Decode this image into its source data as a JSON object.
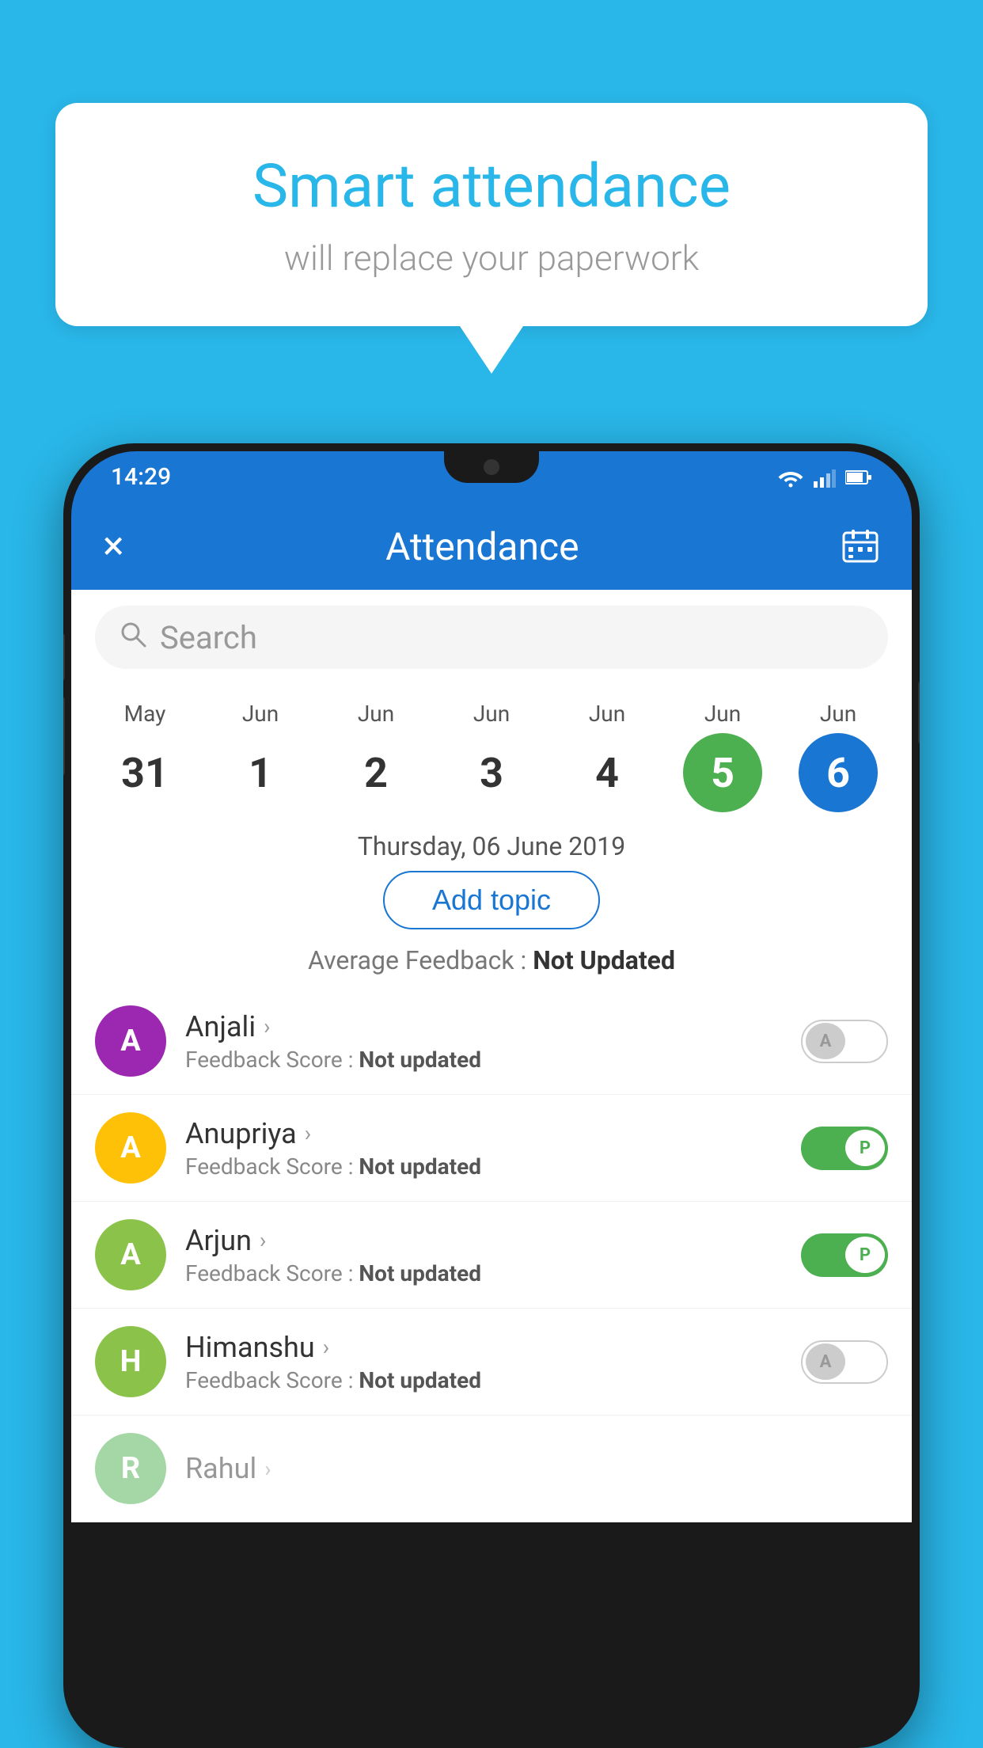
{
  "background_color": "#29B6E8",
  "speech_bubble": {
    "title": "Smart attendance",
    "subtitle": "will replace your paperwork"
  },
  "status_bar": {
    "time": "14:29",
    "wifi_icon": "wifi",
    "signal_icon": "signal",
    "battery_icon": "battery"
  },
  "app_bar": {
    "title": "Attendance",
    "close_label": "×",
    "calendar_icon": "calendar"
  },
  "search": {
    "placeholder": "Search"
  },
  "calendar": {
    "days": [
      {
        "month": "May",
        "date": "31",
        "state": "normal"
      },
      {
        "month": "Jun",
        "date": "1",
        "state": "normal"
      },
      {
        "month": "Jun",
        "date": "2",
        "state": "normal"
      },
      {
        "month": "Jun",
        "date": "3",
        "state": "normal"
      },
      {
        "month": "Jun",
        "date": "4",
        "state": "normal"
      },
      {
        "month": "Jun",
        "date": "5",
        "state": "today"
      },
      {
        "month": "Jun",
        "date": "6",
        "state": "selected"
      }
    ]
  },
  "selected_date": "Thursday, 06 June 2019",
  "add_topic_label": "Add topic",
  "average_feedback_label": "Average Feedback :",
  "average_feedback_value": "Not Updated",
  "students": [
    {
      "name": "Anjali",
      "avatar_letter": "A",
      "avatar_color": "#9C27B0",
      "feedback_label": "Feedback Score :",
      "feedback_value": "Not updated",
      "attendance": "off",
      "toggle_label": "A"
    },
    {
      "name": "Anupriya",
      "avatar_letter": "A",
      "avatar_color": "#FFC107",
      "feedback_label": "Feedback Score :",
      "feedback_value": "Not updated",
      "attendance": "on",
      "toggle_label": "P"
    },
    {
      "name": "Arjun",
      "avatar_letter": "A",
      "avatar_color": "#8BC34A",
      "feedback_label": "Feedback Score :",
      "feedback_value": "Not updated",
      "attendance": "on",
      "toggle_label": "P"
    },
    {
      "name": "Himanshu",
      "avatar_letter": "H",
      "avatar_color": "#8BC34A",
      "feedback_label": "Feedback Score :",
      "feedback_value": "Not updated",
      "attendance": "off",
      "toggle_label": "A"
    }
  ]
}
